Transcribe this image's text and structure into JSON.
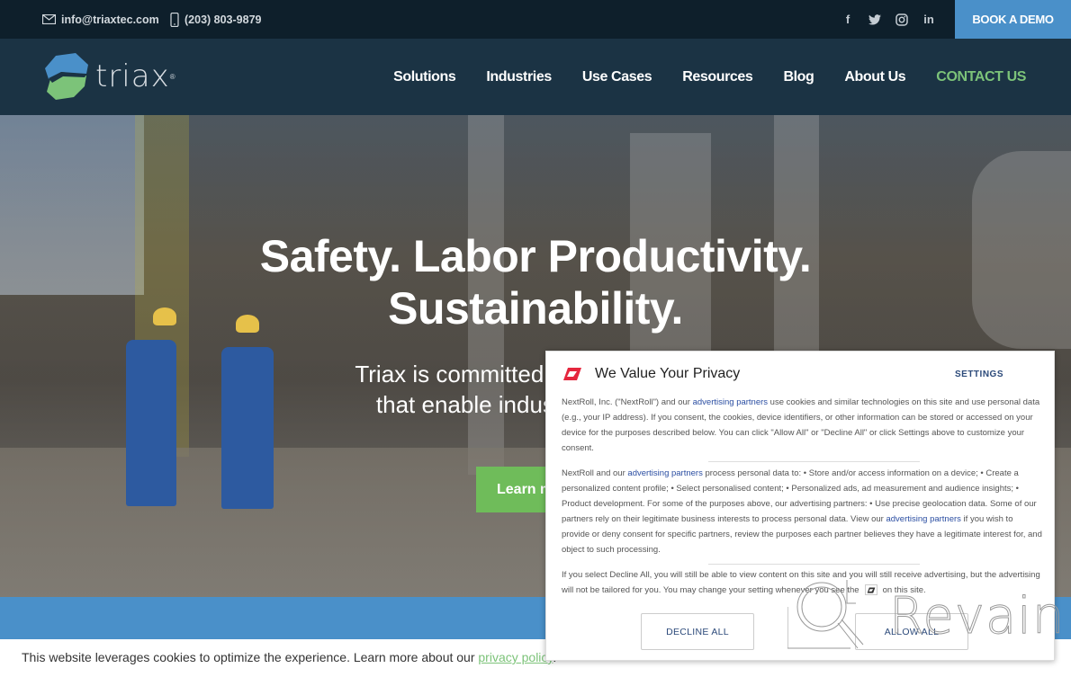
{
  "topbar": {
    "email": "info@triaxtec.com",
    "phone": "(203) 803-9879",
    "social": [
      {
        "name": "facebook",
        "glyph": "f"
      },
      {
        "name": "twitter",
        "glyph": "t"
      },
      {
        "name": "instagram",
        "glyph": "ig"
      },
      {
        "name": "linkedin",
        "glyph": "in"
      }
    ],
    "demo_label": "BOOK A DEMO"
  },
  "nav": {
    "logo_text": "triax",
    "logo_reg": "®",
    "items": [
      "Solutions",
      "Industries",
      "Use Cases",
      "Resources",
      "Blog",
      "About Us",
      "CONTACT US"
    ]
  },
  "hero": {
    "headline_line1": "Safety. Labor Productivity.",
    "headline_line2": "Sustainability.",
    "sub_line1": "Triax is committed to delivering inn",
    "sub_line2": "that enable industrial sites to b",
    "cta_label": "Learn m"
  },
  "cookie_bar": {
    "text": "This website leverages cookies to optimize the experience. Learn more about our ",
    "link": "privacy policy",
    "end": "."
  },
  "consent": {
    "title": "We Value Your Privacy",
    "settings_label": "SETTINGS",
    "p1_a": "NextRoll, Inc. (\"NextRoll\") and our ",
    "p1_link": "advertising partners",
    "p1_b": " use cookies and similar technologies on this site and use personal data (e.g., your IP address). If you consent, the cookies, device identifiers, or other information can be stored or accessed on your device for the purposes described below. You can click \"Allow All\" or \"Decline All\" or click Settings above to customize your consent.",
    "p2_a": "NextRoll and our ",
    "p2_link1": "advertising partners",
    "p2_b": " process personal data to: • Store and/or access information on a device; • Create a personalized content profile; • Select personalised content; • Personalized ads, ad measurement and audience insights; • Product development. For some of the purposes above, our advertising partners: • Use precise geolocation data. Some of our partners rely on their legitimate business interests to process personal data. View our ",
    "p2_link2": "advertising partners",
    "p2_c": " if you wish to provide or deny consent for specific partners, review the purposes each partner believes they have a legitimate interest for, and object to such processing.",
    "p3_a": "If you select Decline All, you will still be able to view content on this site and you will still receive advertising, but the advertising will not be tailored for you. You may change your setting whenever you see the",
    "p3_b": "on this site.",
    "decline_label": "DECLINE ALL",
    "allow_label": "ALLOW ALL"
  },
  "watermark": {
    "text": "Revain"
  },
  "colors": {
    "topbar_bg": "#0e1f2b",
    "nav_bg": "#1b3344",
    "accent_blue": "#4a90c9",
    "accent_green": "#7cc379",
    "cta_green": "#6fbc5a",
    "nextroll_red": "#e5263d"
  }
}
